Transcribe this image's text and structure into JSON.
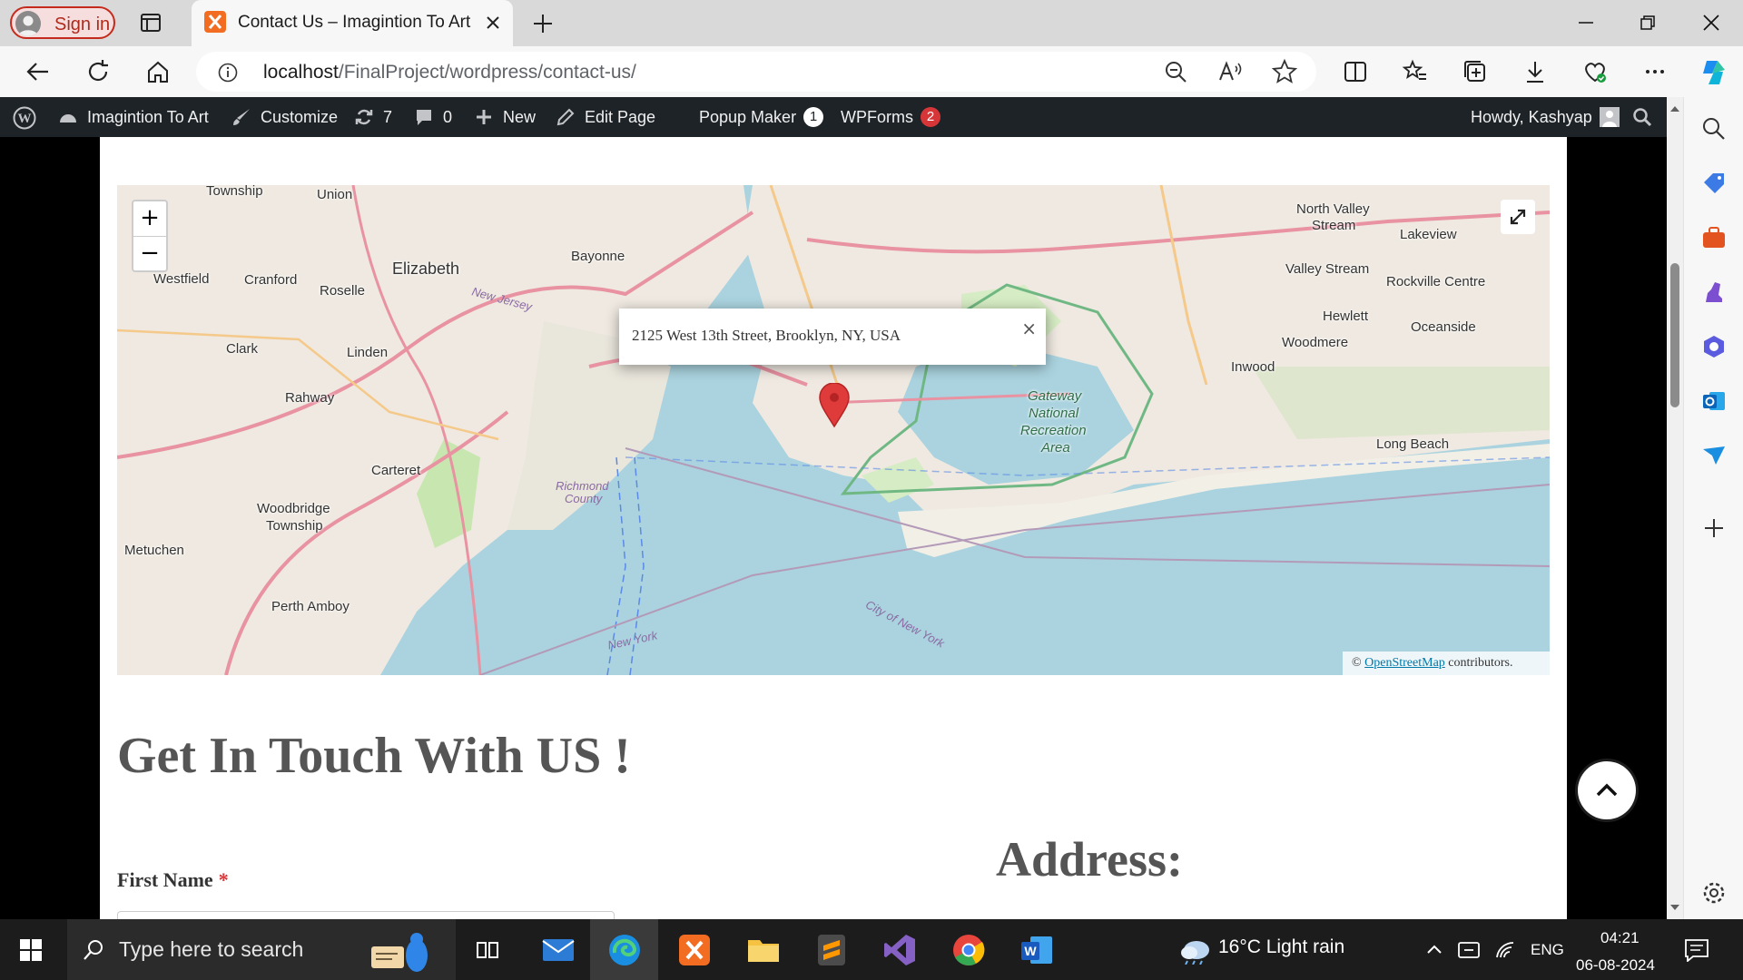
{
  "browser": {
    "sign_in_label": "Sign in",
    "tab_title": "Contact Us – Imagintion To Art",
    "url_host": "localhost",
    "url_path": "/FinalProject/wordpress/contact-us/"
  },
  "adminbar": {
    "site_name": "Imagintion To Art",
    "customize": "Customize",
    "updates_count": "7",
    "comments_count": "0",
    "new": "New",
    "edit_page": "Edit Page",
    "popup_maker": "Popup Maker",
    "popup_maker_count": "1",
    "wpforms": "WPForms",
    "wpforms_count": "2",
    "howdy": "Howdy, Kashyap"
  },
  "map": {
    "zoom_in": "+",
    "zoom_out": "−",
    "popup_text": "2125 West 13th Street, Brooklyn, NY, USA",
    "popup_close": "×",
    "attribution_prefix": "©",
    "attribution_link": "OpenStreetMap",
    "attribution_suffix": "contributors.",
    "labels": {
      "elizabeth": "Elizabeth",
      "bayonne": "Bayonne",
      "westfield": "Westfield",
      "cranford": "Cranford",
      "roselle": "Roselle",
      "union": "Union",
      "township": "Township",
      "clark": "Clark",
      "linden": "Linden",
      "rahway": "Rahway",
      "carteret": "Carteret",
      "woodbridge": "Woodbridge",
      "woodbridge_twp": "Township",
      "metuchen": "Metuchen",
      "perth_amboy": "Perth Amboy",
      "new_jersey": "New Jersey",
      "richmond": "Richmond",
      "county": "County",
      "gateway1": "Gateway",
      "gateway2": "National",
      "gateway3": "Recreation",
      "gateway4": "Area",
      "north_valley": "North Valley",
      "stream": "Stream",
      "lakeview": "Lakeview",
      "valley_stream": "Valley Stream",
      "rockville": "Rockville Centre",
      "hewlett": "Hewlett",
      "oceanside": "Oceanside",
      "woodmere": "Woodmere",
      "inwood": "Inwood",
      "long_beach": "Long Beach",
      "new_york": "New York",
      "city_of_ny": "City of New York"
    }
  },
  "content": {
    "heading": "Get In Touch With US !",
    "address_heading": "Address:",
    "first_name_label": "First Name",
    "required_mark": "*"
  },
  "taskbar": {
    "search_placeholder": "Type here to search",
    "weather": "16°C  Light rain",
    "language": "ENG",
    "time": "04:21",
    "date": "06-08-2024"
  },
  "colors": {
    "admin_bar": "#1d2327",
    "heading": "#555555",
    "accent_red": "#d63638",
    "map_water": "#aad3df"
  }
}
